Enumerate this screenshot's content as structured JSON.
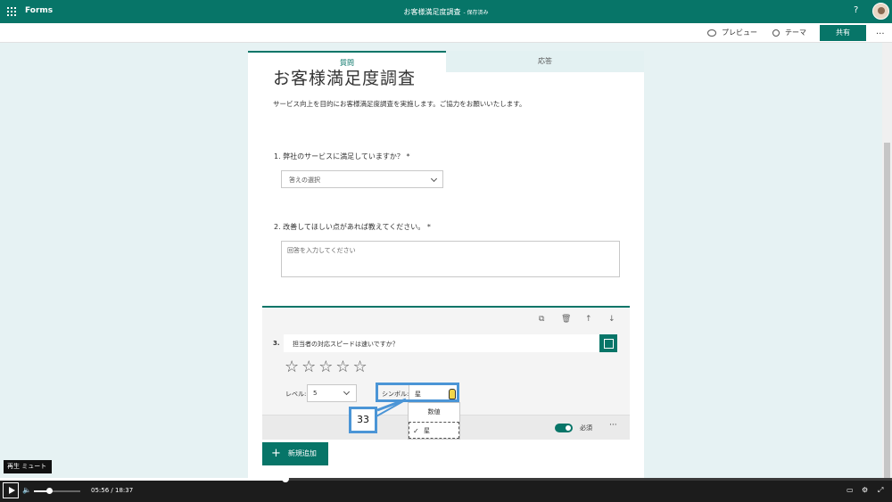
{
  "topbar": {
    "app_name": "Forms",
    "doc_title": "お客様満足度調査",
    "save_status": "- 保存済み",
    "help": "?"
  },
  "cmdbar": {
    "preview": "プレビュー",
    "theme": "テーマ",
    "share": "共有",
    "more": "..."
  },
  "tabs": {
    "questions": "質問",
    "responses": "応答"
  },
  "form": {
    "title": "お客様満足度調査",
    "description": "サービス向上を目的にお客様満足度調査を実施します。ご協力をお願いいたします。",
    "q1": {
      "label": "1. 弊社のサービスに満足していますか？ *",
      "placeholder": "答えの選択"
    },
    "q2": {
      "label": "2. 改善してほしい点があれば教えてください。 *",
      "placeholder": "回答を入力してください"
    },
    "q3": {
      "number": "3.",
      "text": "担当者の対応スピードは速いですか？",
      "stars": "☆☆☆☆☆",
      "level_label": "レベル:",
      "level_value": "5",
      "symbol_label": "シンボル:",
      "symbol_value": "星",
      "required_label": "必須",
      "more": "···",
      "tools": {
        "copy": "⧉",
        "delete": "🗑",
        "up": "↑",
        "down": "↓"
      }
    },
    "symbol_menu": {
      "option_number": "数値",
      "option_star": "星",
      "check": "✓"
    },
    "add_new": "新規追加"
  },
  "annotation": {
    "callout_number": "33"
  },
  "video": {
    "tooltip": "再生  ミュート",
    "current_time": "05:56",
    "separator": "/",
    "total_time": "18:37",
    "progress": 0.32,
    "volume": 0.32
  }
}
